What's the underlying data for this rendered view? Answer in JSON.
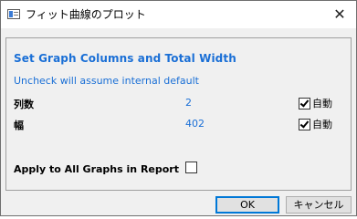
{
  "window": {
    "title": "フィット曲線のプロット",
    "close_glyph": "✕"
  },
  "panel": {
    "heading": "Set Graph Columns and Total Width",
    "subtext": "Uncheck will assume internal default",
    "rows": [
      {
        "label": "列数",
        "value": "2",
        "auto_label": "自動",
        "auto_checked": true
      },
      {
        "label": "幅",
        "value": "402",
        "auto_label": "自動",
        "auto_checked": true
      }
    ],
    "apply_label": "Apply to All Graphs in Report",
    "apply_checked": false
  },
  "buttons": {
    "ok": "OK",
    "cancel": "キャンセル"
  },
  "colors": {
    "accent": "#1a6fd6",
    "default_button_border": "#0078d7"
  },
  "icons": {
    "app": "plot-window-icon",
    "close": "close-icon",
    "check": "checkmark-icon"
  }
}
